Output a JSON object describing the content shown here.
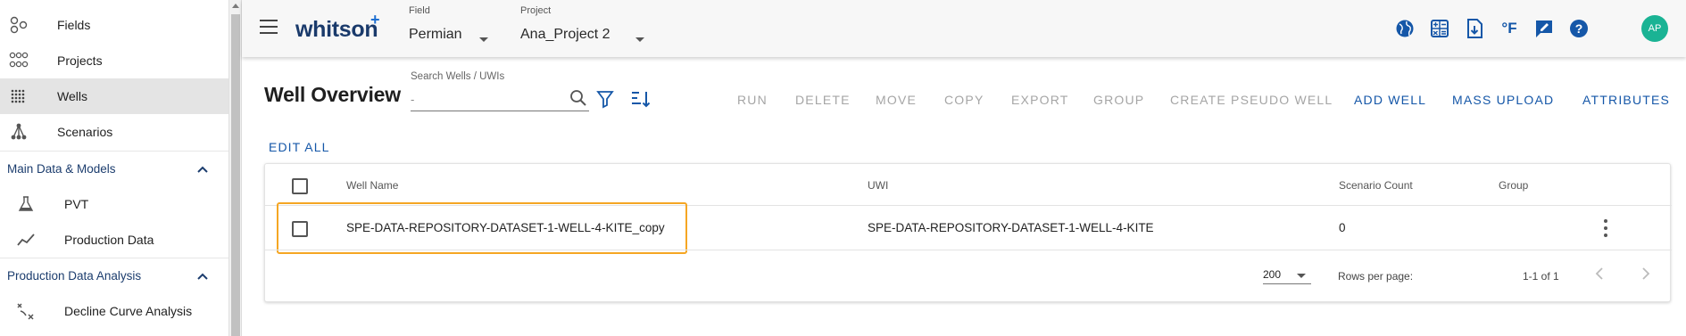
{
  "sidebar": {
    "items": [
      {
        "label": "Fields",
        "icon": "fields-icon"
      },
      {
        "label": "Projects",
        "icon": "projects-icon"
      },
      {
        "label": "Wells",
        "icon": "wells-grid-icon"
      },
      {
        "label": "Scenarios",
        "icon": "scenarios-tree-icon"
      }
    ],
    "sections": [
      {
        "label": "Main Data & Models",
        "items": [
          {
            "label": "PVT",
            "icon": "flask-icon"
          },
          {
            "label": "Production Data",
            "icon": "line-chart-icon"
          }
        ]
      },
      {
        "label": "Production Data Analysis",
        "items": [
          {
            "label": "Decline Curve Analysis",
            "icon": "dca-icon"
          }
        ]
      }
    ]
  },
  "topbar": {
    "logo": "whitson",
    "logo_plus": "+",
    "field_caption": "Field",
    "field_value": "Permian",
    "project_caption": "Project",
    "project_value": "Ana_Project 2",
    "icons": [
      "globe-icon",
      "calculator-icon",
      "download-file-icon",
      "fahrenheit-icon",
      "feedback-icon",
      "help-icon"
    ],
    "units_label": "°F",
    "avatar_initials": "AP",
    "avatar_color": "#1ab394"
  },
  "main": {
    "title": "Well Overview",
    "search_caption": "Search Wells / UWIs",
    "search_value": "-",
    "actions": [
      {
        "label": "RUN",
        "enabled": false
      },
      {
        "label": "DELETE",
        "enabled": false
      },
      {
        "label": "MOVE",
        "enabled": false
      },
      {
        "label": "COPY",
        "enabled": false
      },
      {
        "label": "EXPORT",
        "enabled": false
      },
      {
        "label": "GROUP",
        "enabled": false
      },
      {
        "label": "CREATE PSEUDO WELL",
        "enabled": false
      },
      {
        "label": "ADD WELL",
        "enabled": true
      },
      {
        "label": "MASS UPLOAD",
        "enabled": true
      },
      {
        "label": "ATTRIBUTES",
        "enabled": true
      }
    ],
    "edit_all": "EDIT ALL",
    "accent_color": "#1557a8",
    "highlight_color": "#f5a623"
  },
  "table": {
    "columns": [
      "Well Name",
      "UWI",
      "Scenario Count",
      "Group"
    ],
    "rows": [
      {
        "well_name": "SPE-DATA-REPOSITORY-DATASET-1-WELL-4-KITE_copy",
        "uwi": "SPE-DATA-REPOSITORY-DATASET-1-WELL-4-KITE",
        "scenario_count": "0",
        "group": ""
      }
    ],
    "rows_per_page_label": "Rows per page:",
    "rows_per_page": "200",
    "page_range": "1-1 of 1"
  }
}
